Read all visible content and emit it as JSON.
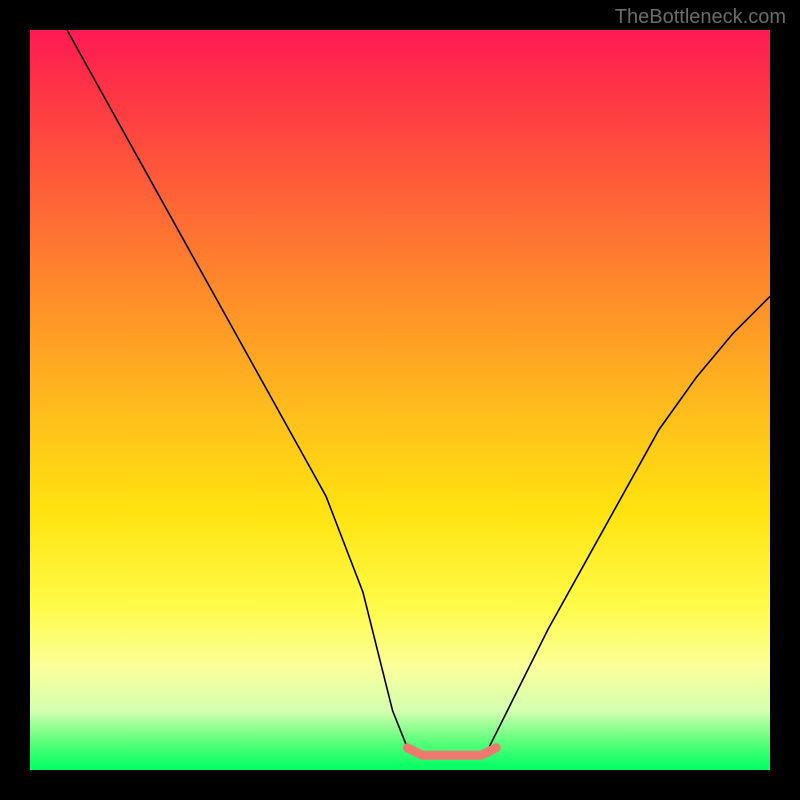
{
  "watermark": "TheBottleneck.com",
  "chart_data": {
    "type": "line",
    "title": "",
    "xlabel": "",
    "ylabel": "",
    "xlim": [
      0,
      100
    ],
    "ylim": [
      0,
      100
    ],
    "series": [
      {
        "name": "curve",
        "x": [
          5,
          10,
          15,
          20,
          25,
          30,
          35,
          40,
          45,
          49,
          51,
          54,
          56,
          58,
          60,
          62,
          65,
          70,
          75,
          80,
          85,
          90,
          95,
          100
        ],
        "y": [
          100,
          91,
          82,
          73,
          64,
          55,
          46,
          37,
          24,
          8,
          3,
          2,
          2,
          2,
          2,
          3,
          9,
          19,
          28,
          37,
          46,
          53,
          59,
          64
        ]
      },
      {
        "name": "highlight-band",
        "x": [
          51,
          53,
          55,
          57,
          59,
          61,
          63
        ],
        "y": [
          3,
          2,
          2,
          2,
          2,
          2,
          3
        ]
      }
    ],
    "colors": {
      "curve": "#000000",
      "highlight": "#ee796f",
      "gradient_top": "#ff1a55",
      "gradient_bottom": "#00ff66"
    }
  }
}
